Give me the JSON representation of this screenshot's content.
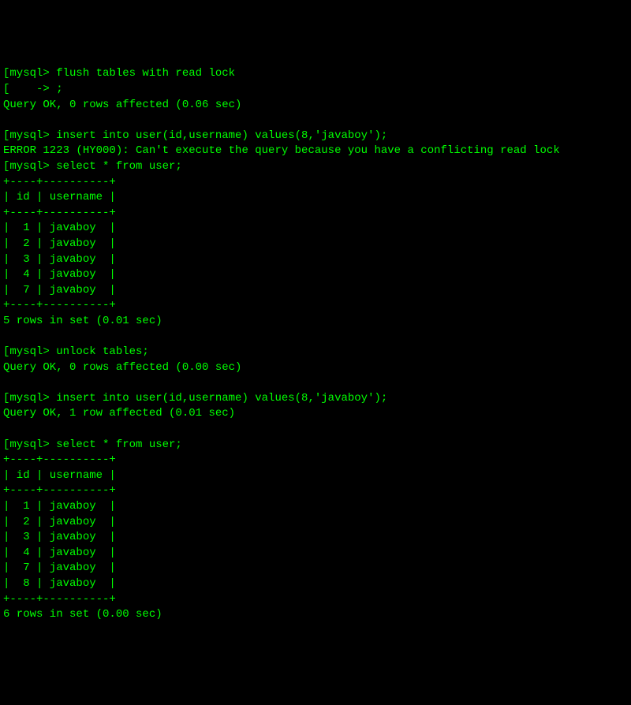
{
  "lines": [
    "[mysql> flush tables with read lock",
    "[    -> ;",
    "Query OK, 0 rows affected (0.06 sec)",
    "",
    "[mysql> insert into user(id,username) values(8,'javaboy');",
    "ERROR 1223 (HY000): Can't execute the query because you have a conflicting read lock",
    "[mysql> select * from user;",
    "+----+----------+",
    "| id | username |",
    "+----+----------+",
    "|  1 | javaboy  |",
    "|  2 | javaboy  |",
    "|  3 | javaboy  |",
    "|  4 | javaboy  |",
    "|  7 | javaboy  |",
    "+----+----------+",
    "5 rows in set (0.01 sec)",
    "",
    "[mysql> unlock tables;",
    "Query OK, 0 rows affected (0.00 sec)",
    "",
    "[mysql> insert into user(id,username) values(8,'javaboy');",
    "Query OK, 1 row affected (0.01 sec)",
    "",
    "[mysql> select * from user;",
    "+----+----------+",
    "| id | username |",
    "+----+----------+",
    "|  1 | javaboy  |",
    "|  2 | javaboy  |",
    "|  3 | javaboy  |",
    "|  4 | javaboy  |",
    "|  7 | javaboy  |",
    "|  8 | javaboy  |",
    "+----+----------+",
    "6 rows in set (0.00 sec)"
  ]
}
